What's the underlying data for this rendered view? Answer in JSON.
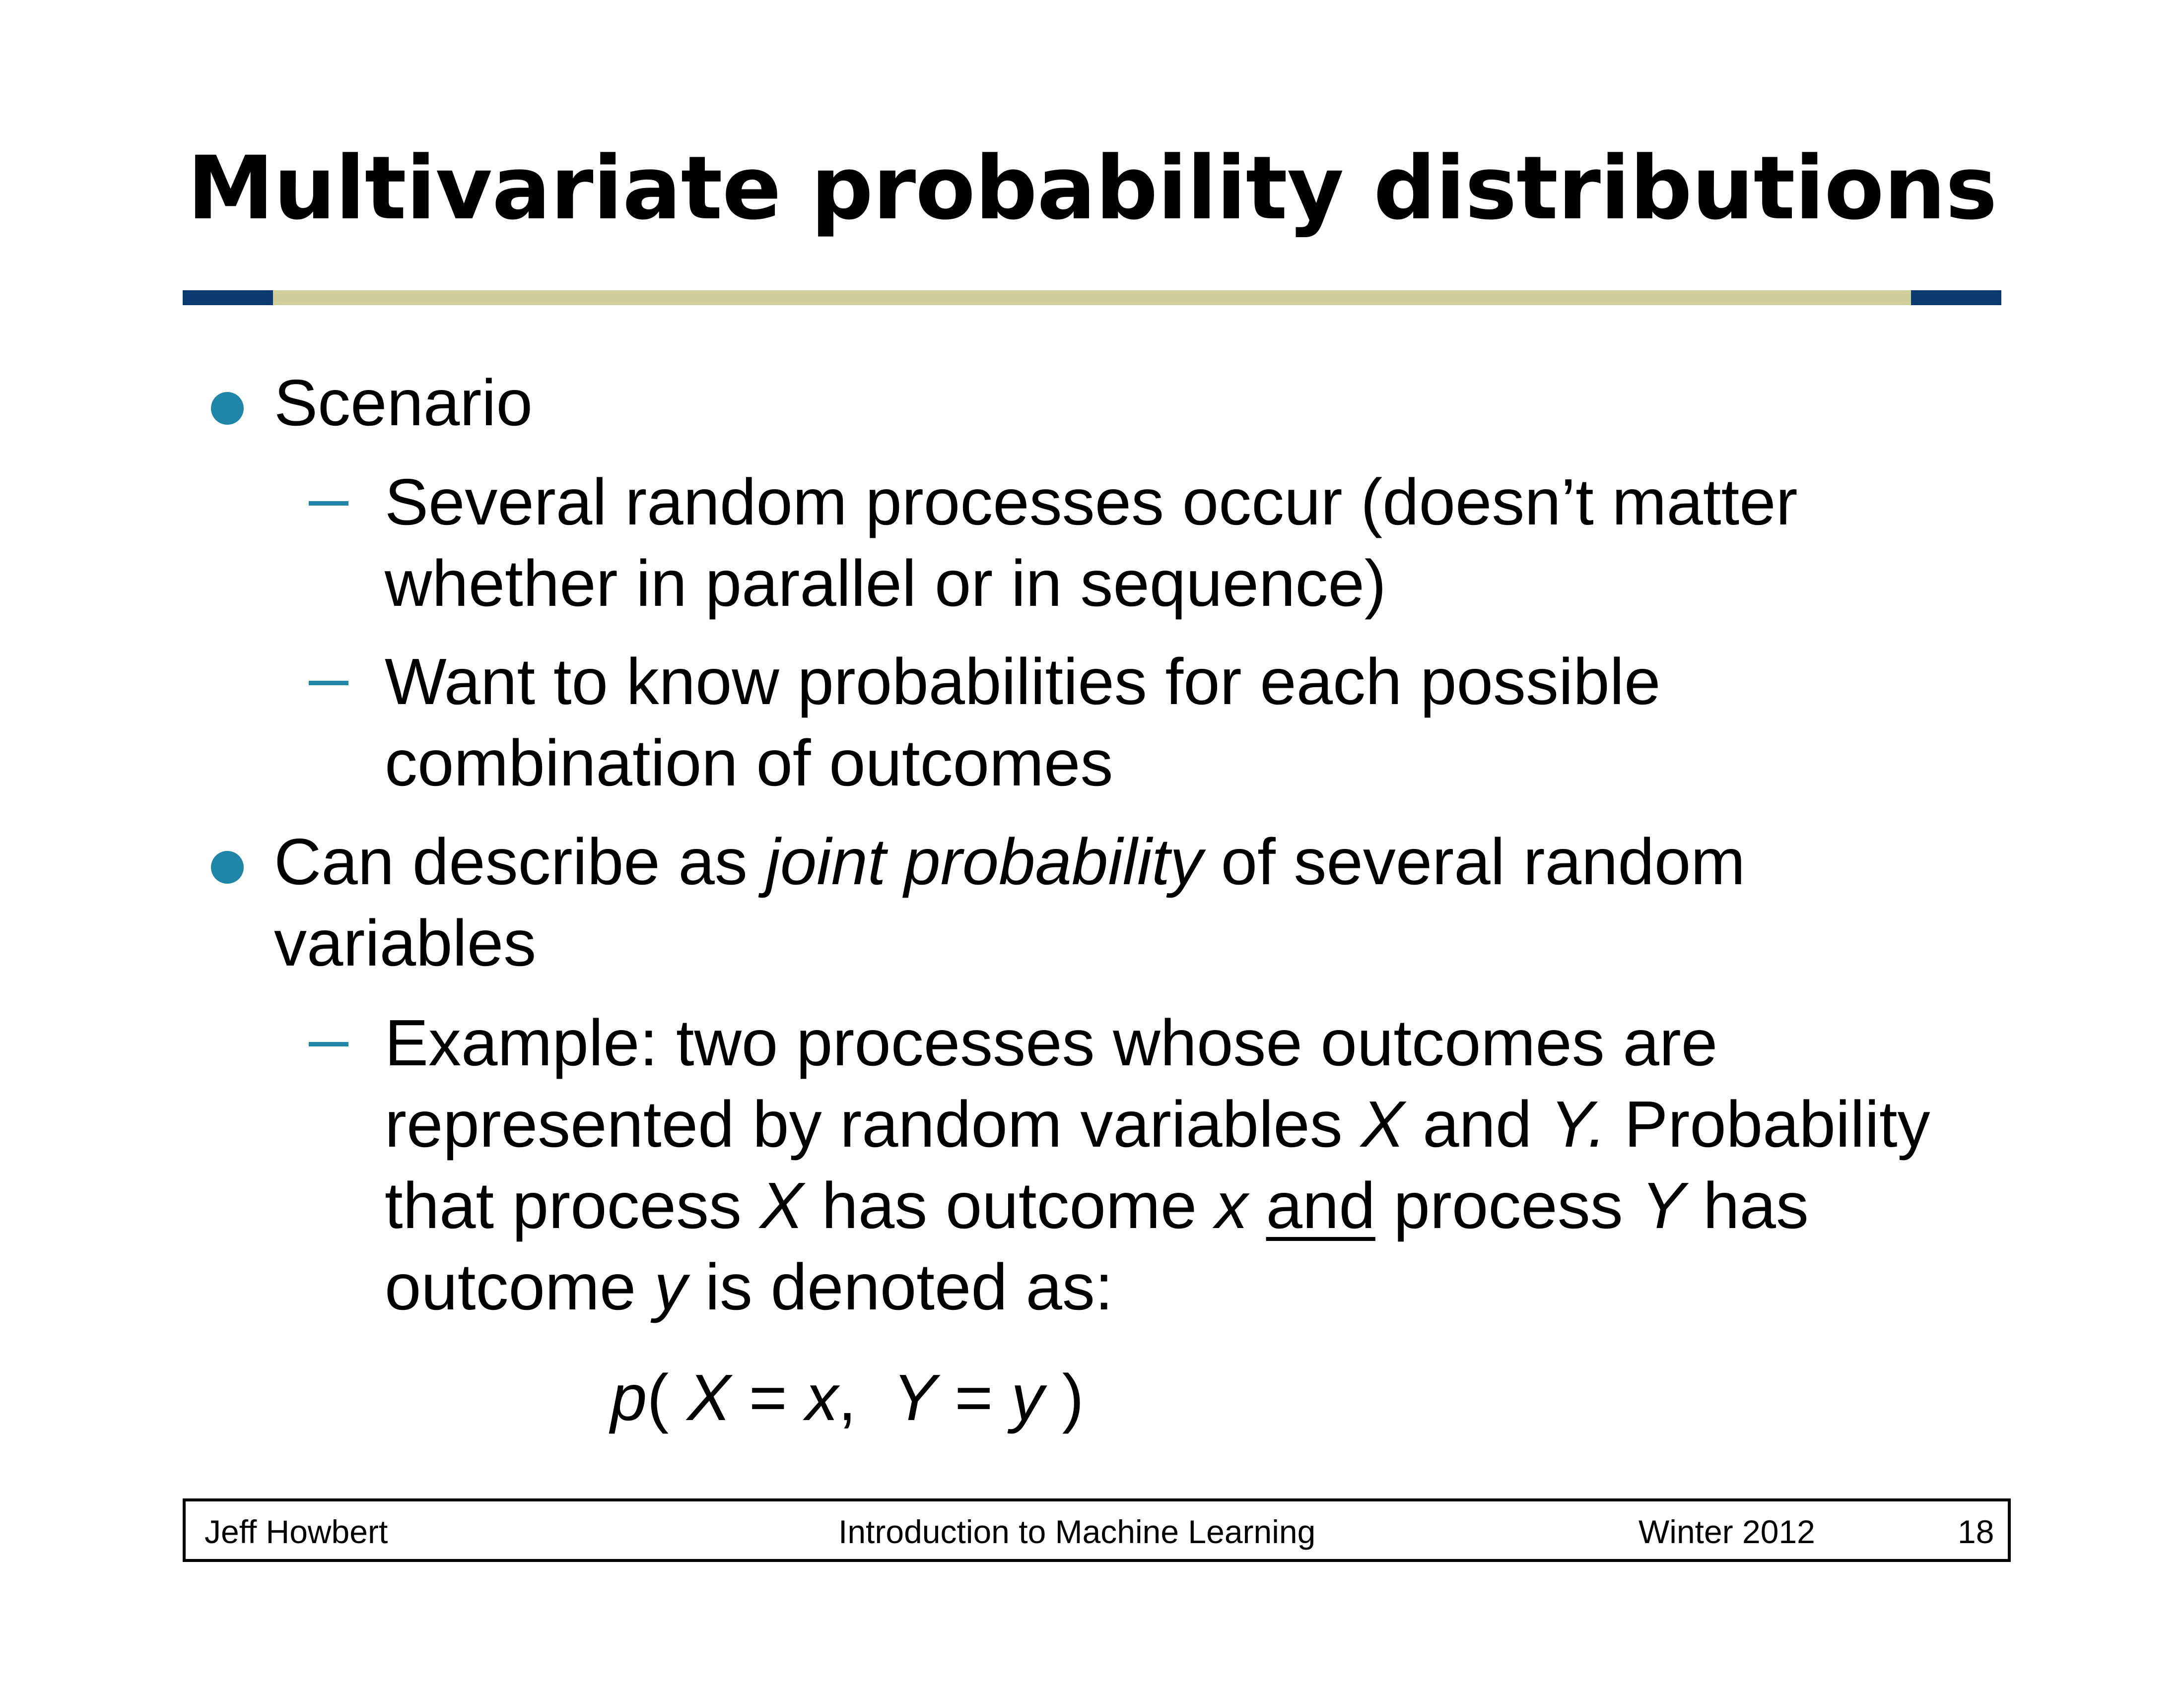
{
  "slide": {
    "title": "Multivariate probability distributions"
  },
  "bullets": {
    "scenario": "Scenario",
    "scenario_sub1": "Several random processes occur (doesn’t matter whether in parallel or in sequence)",
    "scenario_sub2": "Want to know probabilities for each possible combination of outcomes",
    "joint_pre": "Can describe as ",
    "joint_em": "joint probability",
    "joint_post": " of several random variables",
    "example": {
      "t1": "Example: two processes whose outcomes are represented by random variables ",
      "X1": "X",
      "t2": " and ",
      "Y1": "Y.",
      "t3": " Probability that process ",
      "X2": "X",
      "t4": " has outcome ",
      "x1": "x",
      "t5": " ",
      "and": "and",
      "t6": " process ",
      "Y2": "Y",
      "t7": " has outcome ",
      "y1": "y",
      "t8": " is denoted as:"
    }
  },
  "formula": {
    "p": "p",
    "open": "( ",
    "X": "X",
    "eq1": " = ",
    "x": "x",
    "comma": ",  ",
    "Y": "Y",
    "eq2": " = ",
    "y": "y",
    "close": " )"
  },
  "footer": {
    "author": "Jeff Howbert",
    "course": "Introduction to Machine Learning",
    "term": "Winter 2012",
    "page": "18"
  },
  "colors": {
    "bullet": "#1f86a8",
    "rule_ends": "#0b3a70",
    "rule_middle": "#cfcf9e"
  }
}
